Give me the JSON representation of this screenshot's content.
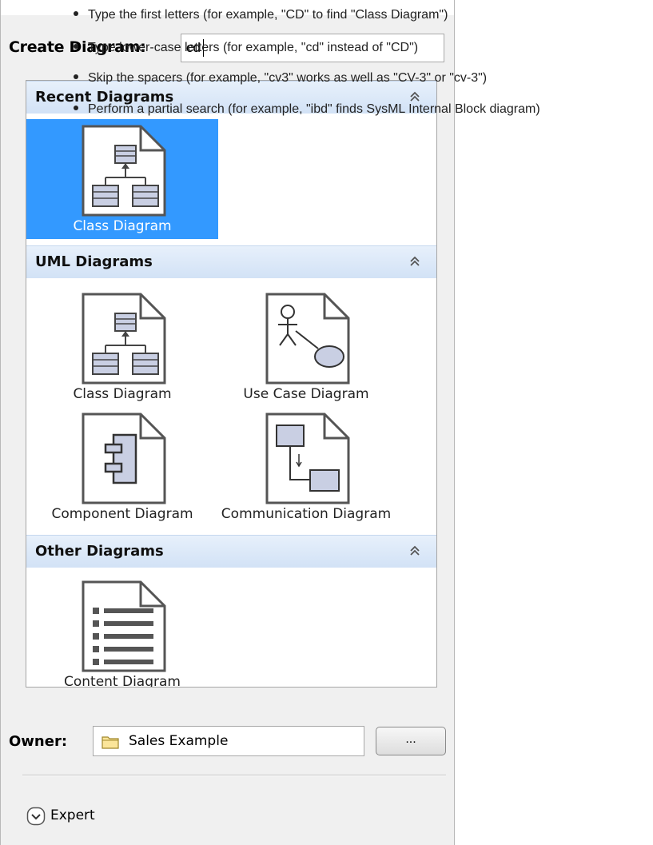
{
  "dialog": {
    "create_label": "Create Diagram:",
    "search_value": "cd"
  },
  "sections": [
    {
      "title": "Recent Diagrams",
      "items": [
        {
          "label": "Class Diagram",
          "icon": "class-diagram-icon",
          "selected": true
        }
      ]
    },
    {
      "title": "UML Diagrams",
      "items": [
        {
          "label": "Class Diagram",
          "icon": "class-diagram-icon"
        },
        {
          "label": "Use Case Diagram",
          "icon": "use-case-diagram-icon"
        },
        {
          "label": "Component Diagram",
          "icon": "component-diagram-icon"
        },
        {
          "label": "Communication Diagram",
          "icon": "communication-diagram-icon"
        }
      ]
    },
    {
      "title": "Other Diagrams",
      "items": [
        {
          "label": "Content Diagram",
          "icon": "content-diagram-icon"
        }
      ]
    }
  ],
  "owner": {
    "label": "Owner:",
    "value": "Sales Example",
    "browse_label": "..."
  },
  "expert": {
    "label": "Expert"
  },
  "tips": [
    "Type the first letters (for example, \"CD\" to find \"Class Diagram\")",
    "Type lower-case letters (for example, \"cd\" instead of \"CD\")",
    "Skip the spacers (for example, \"cv3\" works as well as \"CV-3\" or \"cv-3\")",
    "Perform a partial search (for example, \"ibd\" finds SysML Internal Block diagram)"
  ],
  "colors": {
    "selection": "#3399ff",
    "header": "#d2e2f6"
  }
}
